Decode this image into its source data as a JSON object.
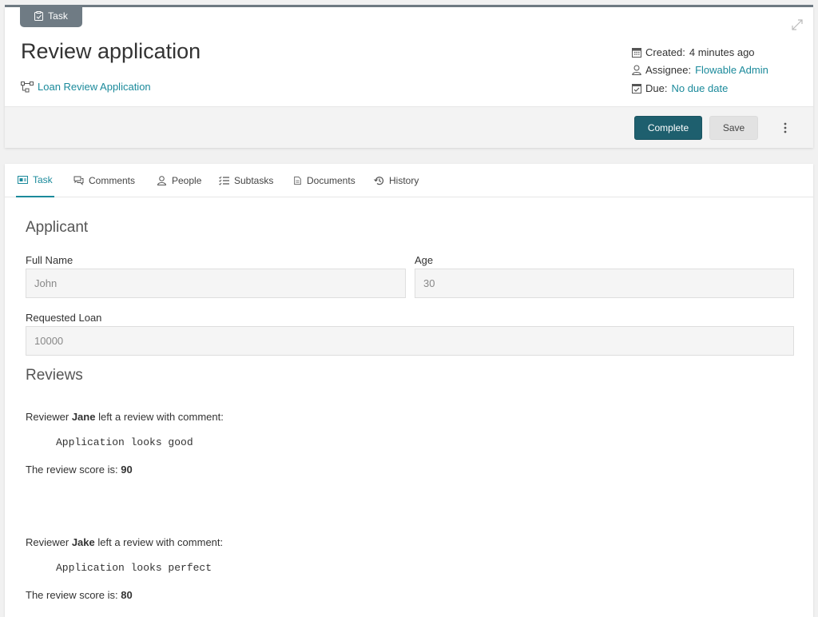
{
  "header": {
    "badge_label": "Task",
    "title": "Review application",
    "process_link": "Loan Review Application",
    "created_label": "Created:",
    "created_value": "4 minutes ago",
    "assignee_label": "Assignee:",
    "assignee_value": "Flowable Admin",
    "due_label": "Due:",
    "due_value": "No due date"
  },
  "actions": {
    "complete_label": "Complete",
    "save_label": "Save"
  },
  "tabs": [
    {
      "label": "Task",
      "icon": "task-form-icon"
    },
    {
      "label": "Comments",
      "icon": "comments-icon"
    },
    {
      "label": "People",
      "icon": "person-icon"
    },
    {
      "label": "Subtasks",
      "icon": "list-icon"
    },
    {
      "label": "Documents",
      "icon": "document-icon"
    },
    {
      "label": "History",
      "icon": "history-icon"
    }
  ],
  "form": {
    "applicant_title": "Applicant",
    "full_name_label": "Full Name",
    "full_name_value": "John",
    "age_label": "Age",
    "age_value": "30",
    "loan_label": "Requested Loan",
    "loan_value": "10000",
    "reviews_title": "Reviews"
  },
  "reviews": [
    {
      "prefix": "Reviewer",
      "reviewer": "Jane",
      "suffix": "left a review with comment:",
      "comment": "Application looks good",
      "score_label": "The review score is:",
      "score": "90"
    },
    {
      "prefix": "Reviewer",
      "reviewer": "Jake",
      "suffix": "left a review with comment:",
      "comment": "Application looks perfect",
      "score_label": "The review score is:",
      "score": "80"
    }
  ],
  "colors": {
    "accent": "#1b8a9b",
    "primary_button": "#1e5f6e",
    "badge": "#6f7b84"
  }
}
